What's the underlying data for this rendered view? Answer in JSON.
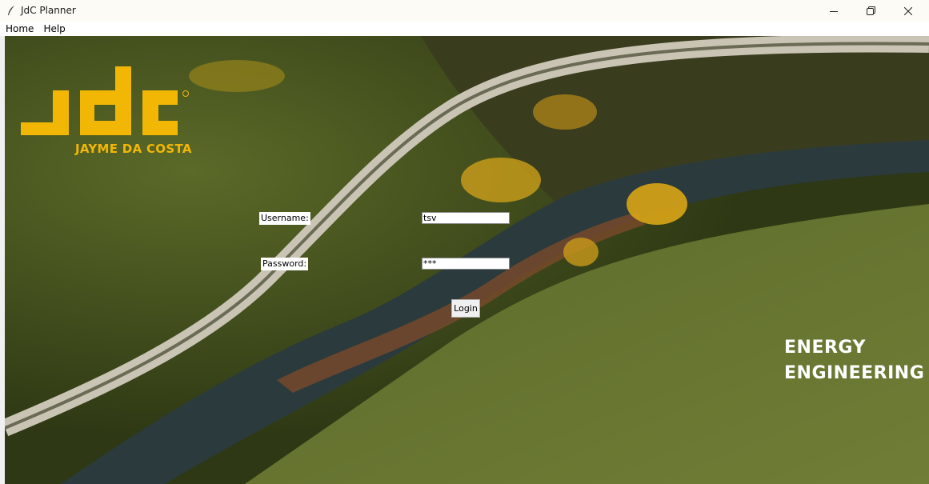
{
  "window": {
    "title": "JdC Planner",
    "icon": "feather-icon"
  },
  "menu": {
    "items": [
      "Home",
      "Help"
    ]
  },
  "branding": {
    "logo_text": "JDC",
    "logo_sub": "JAYME DA COSTA",
    "tagline_line1": "ENERGY",
    "tagline_line2": "ENGINEERING",
    "accent": "#f2b705"
  },
  "login": {
    "username_label": "Username:",
    "username_value": "tsv",
    "password_label": "Password:",
    "password_value": "***",
    "login_button": "Login"
  }
}
